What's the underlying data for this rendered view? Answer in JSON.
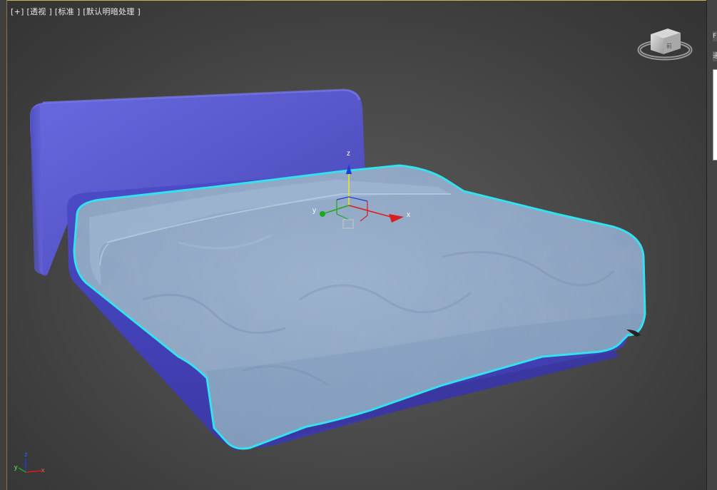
{
  "viewport": {
    "label_parts": [
      "[+]",
      "[透视 ]",
      "[标准 ]",
      "[默认明暗处理 ]"
    ]
  },
  "gizmo": {
    "z_label": "z",
    "x_label": "x",
    "y_label": "y"
  },
  "axis_tripod": {
    "z_label": "z",
    "x_label": "x",
    "y_label": "y"
  },
  "viewcube": {
    "face_label": "前"
  },
  "colors": {
    "headboard": "#5c5cd0",
    "bed_base": "#4a48c4",
    "duvet": "#8fa9c6",
    "selection_outline": "#34e1ee",
    "axis_x": "#d81e1e",
    "axis_y": "#1ea81e",
    "axis_z": "#1e3cd8"
  },
  "right_panel": {
    "btn1": "F",
    "btn2": "通"
  }
}
